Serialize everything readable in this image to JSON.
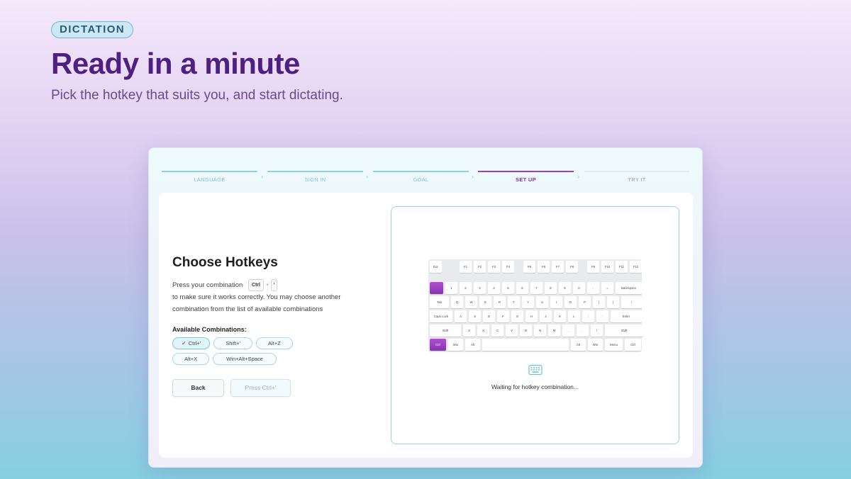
{
  "hero": {
    "tag": "DICTATION",
    "title": "Ready in a minute",
    "subtitle": "Pick the hotkey that suits you, and start dictating."
  },
  "stepper": {
    "steps": [
      {
        "label": "LANGUAGE",
        "state": "done"
      },
      {
        "label": "SIGN IN",
        "state": "done"
      },
      {
        "label": "GOAL",
        "state": "done"
      },
      {
        "label": "SET UP",
        "state": "active"
      },
      {
        "label": "TRY IT",
        "state": "future"
      }
    ],
    "separator": "›"
  },
  "hotkeys": {
    "title": "Choose Hotkeys",
    "desc_before": "Press your combination",
    "combo_keys": [
      "Ctrl",
      "'"
    ],
    "combo_plus": "+",
    "desc_after": "to make sure it works correctly. You may choose another combination from the list of available combinations",
    "available_title": "Available Combinations:",
    "combinations": [
      {
        "label": "Ctrl+'",
        "selected": true
      },
      {
        "label": "Shift+'",
        "selected": false
      },
      {
        "label": "Alt+Z",
        "selected": false
      },
      {
        "label": "Alt+X",
        "selected": false
      },
      {
        "label": "Win+Alt+Space",
        "selected": false
      }
    ],
    "check": "✓",
    "back_label": "Back",
    "press_label": "Press Ctrl+'"
  },
  "keyboard": {
    "rows": [
      [
        "Esc",
        "F1",
        "F2",
        "F3",
        "F4",
        "F5",
        "F6",
        "F7",
        "F8",
        "F9",
        "F10",
        "F11",
        "F12"
      ],
      [
        "",
        "1",
        "2",
        "3",
        "4",
        "5",
        "6",
        "7",
        "8",
        "9",
        "0",
        "-",
        "=",
        "Backspace"
      ],
      [
        "Tab",
        "Q",
        "W",
        "E",
        "R",
        "T",
        "Y",
        "U",
        "I",
        "O",
        "P",
        "[",
        "]",
        "\\"
      ],
      [
        "Caps Lock",
        "A",
        "S",
        "D",
        "F",
        "G",
        "H",
        "J",
        "K",
        "L",
        ";",
        "'",
        "Enter"
      ],
      [
        "Shift",
        "Z",
        "X",
        "C",
        "V",
        "B",
        "N",
        "M",
        ",",
        ".",
        "/",
        "Shift"
      ],
      [
        "Ctrl",
        "Win",
        "Alt",
        "",
        "Alt",
        "Win",
        "Menu",
        "Ctrl"
      ]
    ],
    "highlighted": [
      "Ctrl (left)",
      "` (backtick)"
    ],
    "accent": "#9b3fc2"
  },
  "status": {
    "icon": "keyboard-icon",
    "text": "Waiting for hotkey combination..."
  },
  "colors": {
    "title": "#4f1f82",
    "accent": "#9b3fc2",
    "teal": "#8fd3e2"
  }
}
